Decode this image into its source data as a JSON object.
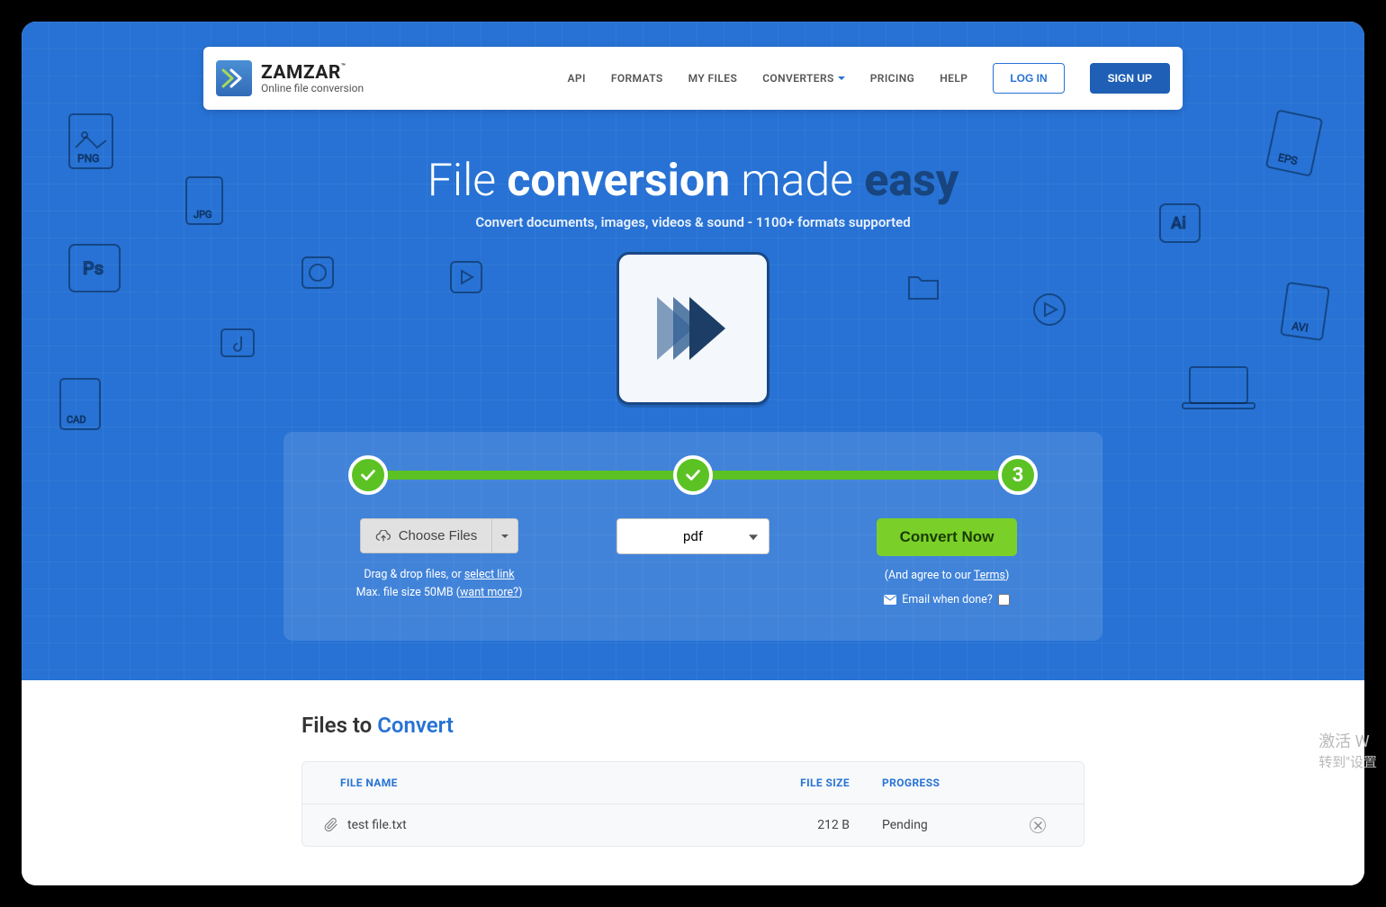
{
  "brand": {
    "name": "ZAMZAR",
    "tm": "™",
    "tagline": "Online file conversion"
  },
  "nav": {
    "api": "API",
    "formats": "FORMATS",
    "myfiles": "MY FILES",
    "converters": "CONVERTERS",
    "pricing": "PRICING",
    "help": "HELP",
    "login": "LOG IN",
    "signup": "SIGN UP"
  },
  "hero": {
    "title_pre": "File ",
    "title_b1": "conversion",
    "title_mid": " made ",
    "title_b2": "easy",
    "subtitle": "Convert documents, images, videos & sound - 1100+ formats supported"
  },
  "steps": {
    "badge3": "3",
    "choose_label": "Choose Files",
    "hint_drag": "Drag & drop files, or ",
    "hint_select_link": "select link",
    "hint_max_pre": "Max. file size 50MB (",
    "hint_want_more": "want more?",
    "hint_max_post": ")",
    "format_selected": "pdf",
    "convert_label": "Convert Now",
    "agree_pre": "(And agree to our ",
    "agree_link": "Terms",
    "agree_post": ")",
    "email_label": "Email when done?"
  },
  "files_section": {
    "title_pre": "Files to ",
    "title_accent": "Convert",
    "col_name": "FILE NAME",
    "col_size": "FILE SIZE",
    "col_progress": "PROGRESS"
  },
  "files": [
    {
      "name": "test file.txt",
      "size": "212 B",
      "progress": "Pending"
    }
  ],
  "watermark": {
    "l1": "激活 W",
    "l2": "转到\"设置"
  }
}
